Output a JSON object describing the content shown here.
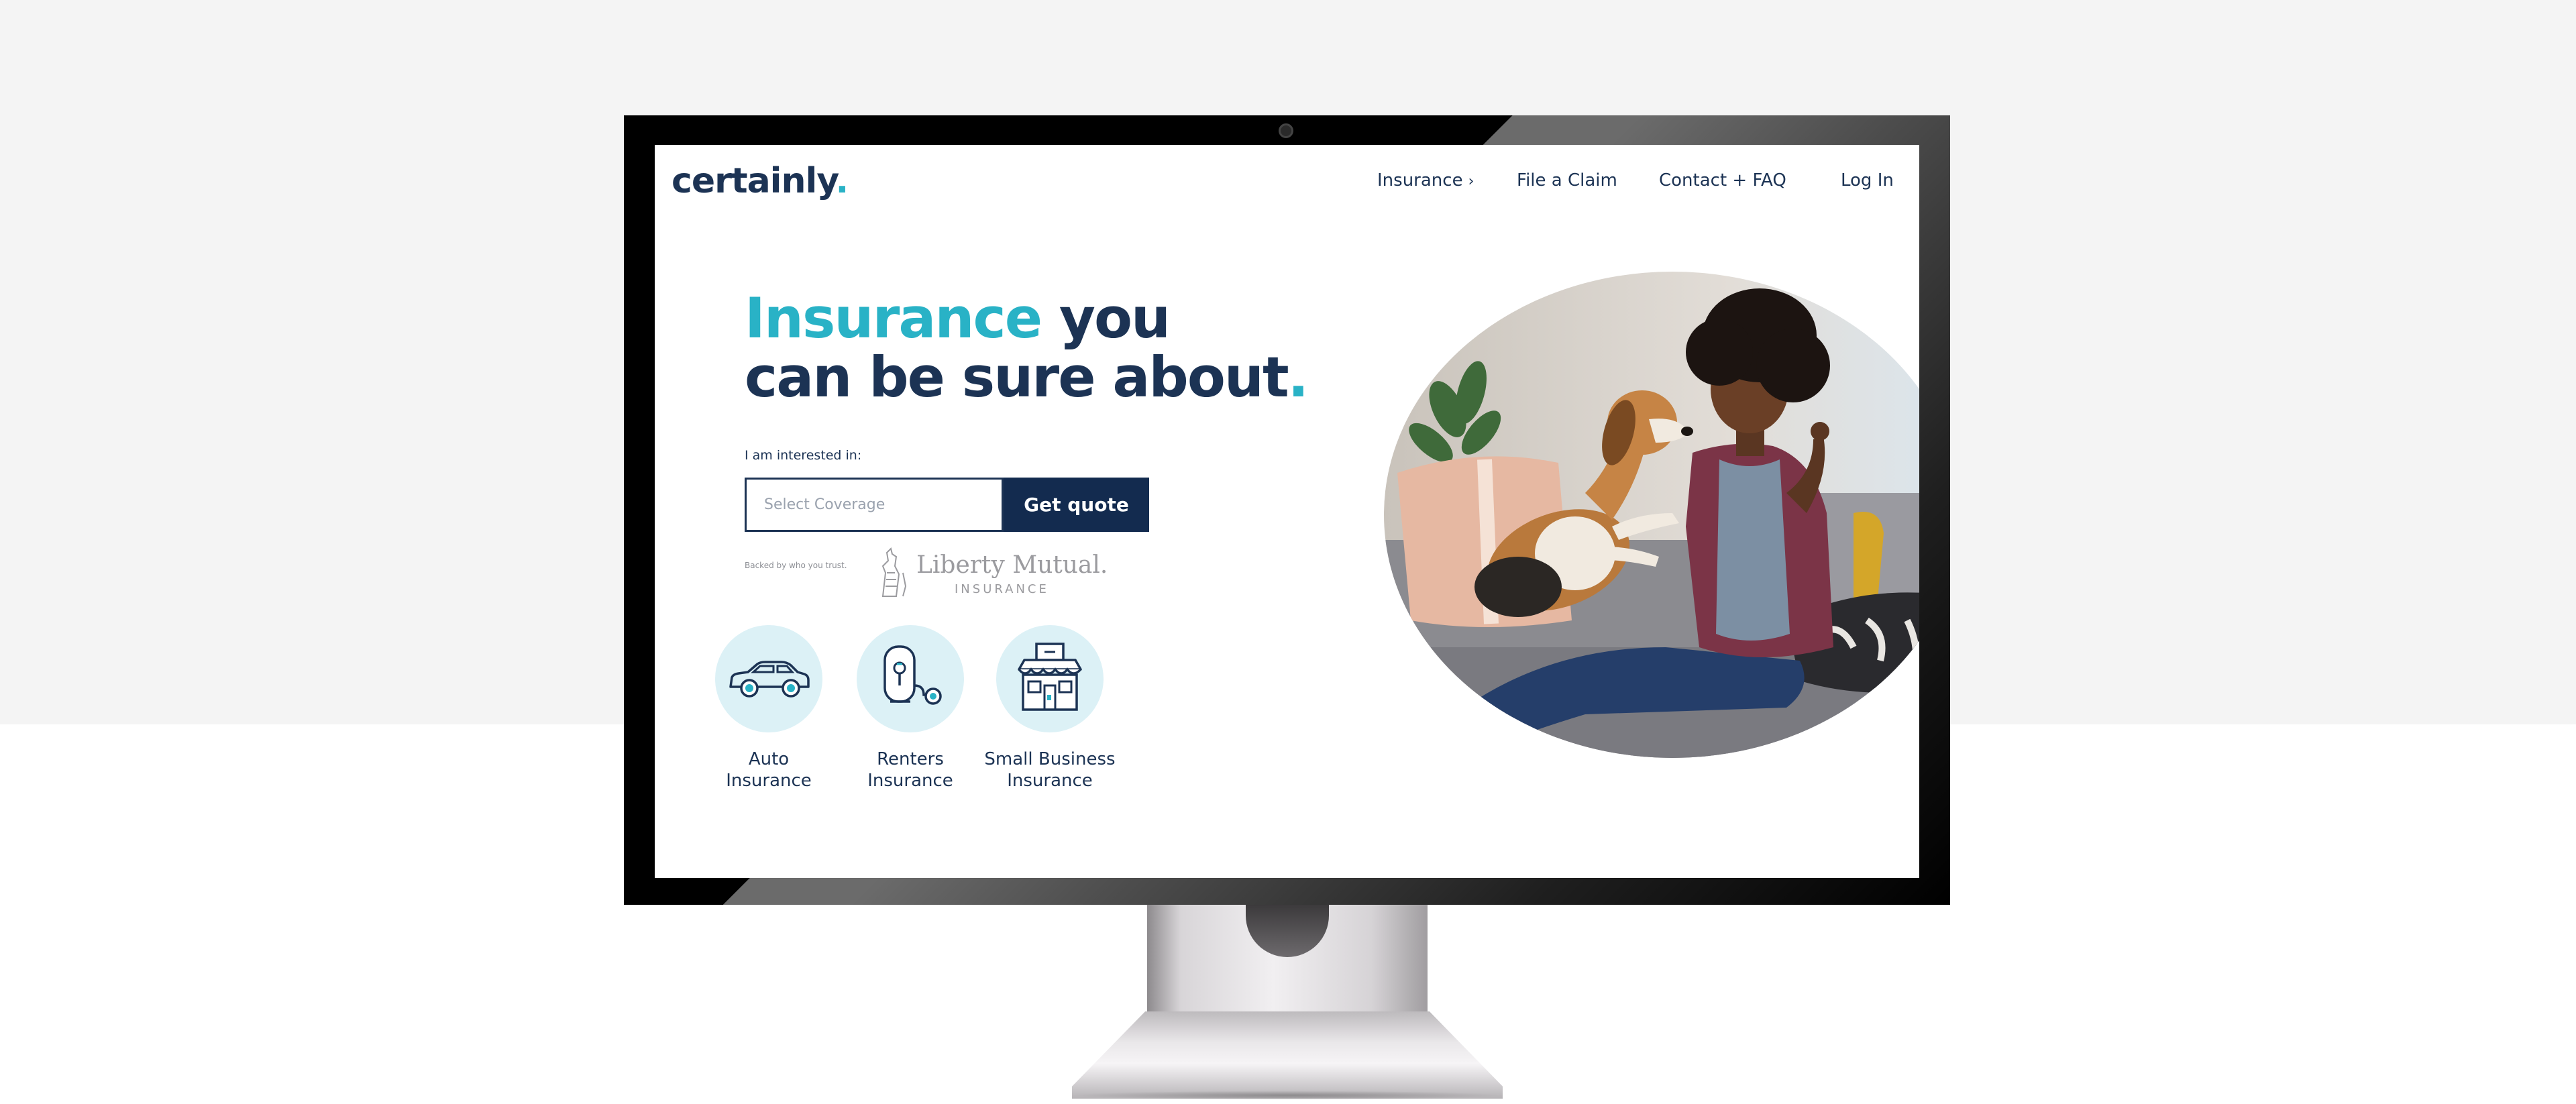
{
  "site": {
    "logo_text": "certainly",
    "logo_dot": "."
  },
  "nav": {
    "items": [
      {
        "label": "Insurance",
        "has_chevron": true
      },
      {
        "label": "File a Claim"
      },
      {
        "label": "Contact + FAQ"
      },
      {
        "label": "Log In"
      }
    ],
    "chevron": "›"
  },
  "hero": {
    "headline_accent": "Insurance",
    "headline_line1_rest": "you",
    "headline_line2": "can be sure about",
    "headline_dot": "."
  },
  "form": {
    "label": "I am interested in:",
    "select_placeholder": "Select Coverage",
    "button_label": "Get quote"
  },
  "backed": {
    "text": "Backed by who you trust.",
    "partner_name": "Liberty Mutual.",
    "partner_sub": "INSURANCE"
  },
  "products": [
    {
      "line1": "Auto",
      "line2": "Insurance",
      "icon": "car-icon"
    },
    {
      "line1": "Renters",
      "line2": "Insurance",
      "icon": "door-key-icon"
    },
    {
      "line1": "Small Business",
      "line2": "Insurance",
      "icon": "storefront-icon"
    }
  ],
  "colors": {
    "navy": "#1c3354",
    "teal": "#29b2c6",
    "button": "#132b4f",
    "icon_bg": "#dcf1f6",
    "page_bg": "#f4f4f4"
  }
}
